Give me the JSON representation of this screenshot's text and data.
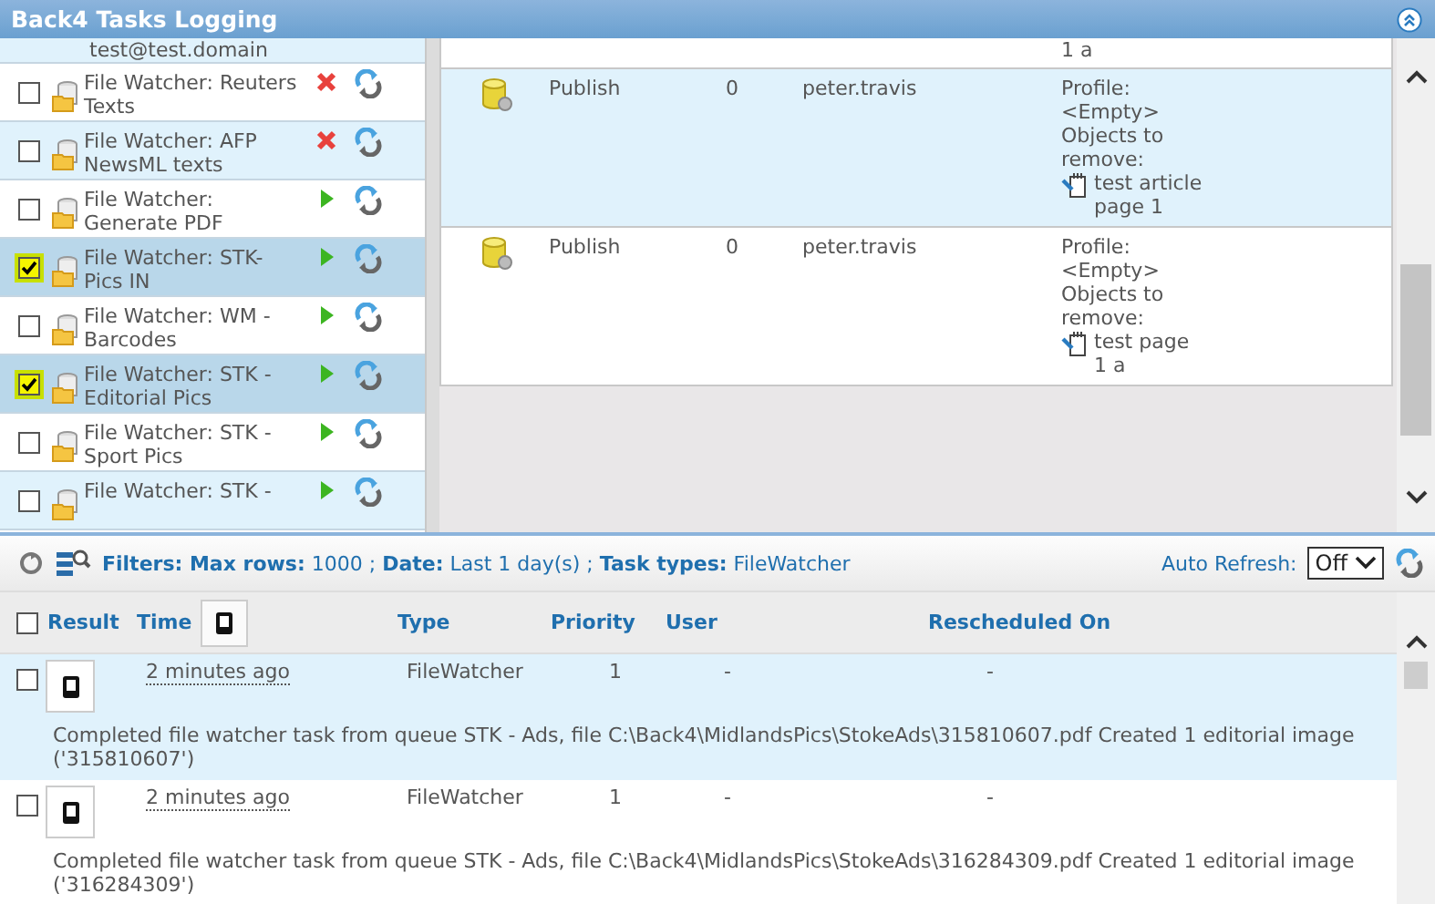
{
  "window": {
    "title": "Back4 Tasks Logging"
  },
  "task_list": {
    "items": [
      {
        "label": "test@test.domain",
        "kind": "fragment"
      },
      {
        "label": "File Watcher: Reuters Texts",
        "kind": "task",
        "checked": false,
        "failed": true
      },
      {
        "label": "File Watcher: AFP NewsML texts",
        "kind": "task",
        "checked": false,
        "failed": true
      },
      {
        "label": "File Watcher: Generate PDF",
        "kind": "task",
        "checked": false,
        "failed": false
      },
      {
        "label": "File Watcher: STK-Pics IN",
        "kind": "task",
        "checked": true,
        "failed": false
      },
      {
        "label": "File Watcher: WM - Barcodes",
        "kind": "task",
        "checked": false,
        "failed": false
      },
      {
        "label": "File Watcher: STK - Editorial Pics",
        "kind": "task",
        "checked": true,
        "failed": false
      },
      {
        "label": "File Watcher: STK - Sport Pics",
        "kind": "task",
        "checked": false,
        "failed": false
      },
      {
        "label": "File Watcher: STK -",
        "kind": "task",
        "checked": false,
        "failed": false
      }
    ]
  },
  "actions_table": {
    "rows": [
      {
        "kind": "fragment",
        "object_tail": "1 a"
      },
      {
        "kind": "full",
        "action": "Publish",
        "priority": "0",
        "user": "peter.travis",
        "profile": "Profile: <Empty>",
        "objects_label": "Objects to remove:",
        "object": "test article page 1"
      },
      {
        "kind": "full",
        "action": "Publish",
        "priority": "0",
        "user": "peter.travis",
        "profile": "Profile: <Empty>",
        "objects_label": "Objects to remove:",
        "object": "test page 1 a"
      }
    ]
  },
  "log": {
    "filters": "**Filters: Max rows:** 1000 ; **Date:** Last 1 day(s) ; **Task types:** FileWatcher",
    "auto_refresh_label": "Auto Refresh:",
    "auto_refresh_value": "Off",
    "select_all_checked": false,
    "columns": [
      "Result",
      "Time",
      "Type",
      "Priority",
      "User",
      "Rescheduled On"
    ],
    "rows": [
      {
        "selected": true,
        "checked": false,
        "time": "2 minutes ago",
        "type": "FileWatcher",
        "priority": "1",
        "user": "-",
        "rescheduled": "-",
        "message": "Completed file watcher task from queue STK - Ads, file C:\\Back4\\MidlandsPics\\StokeAds\\315810607.pdf Created 1 editorial image ('315810607')"
      },
      {
        "selected": false,
        "checked": false,
        "time": "2 minutes ago",
        "type": "FileWatcher",
        "priority": "1",
        "user": "-",
        "rescheduled": "-",
        "message": "Completed file watcher task from queue STK - Ads, file C:\\Back4\\MidlandsPics\\StokeAds\\316284309.pdf Created 1 editorial image ('316284309')"
      }
    ]
  }
}
